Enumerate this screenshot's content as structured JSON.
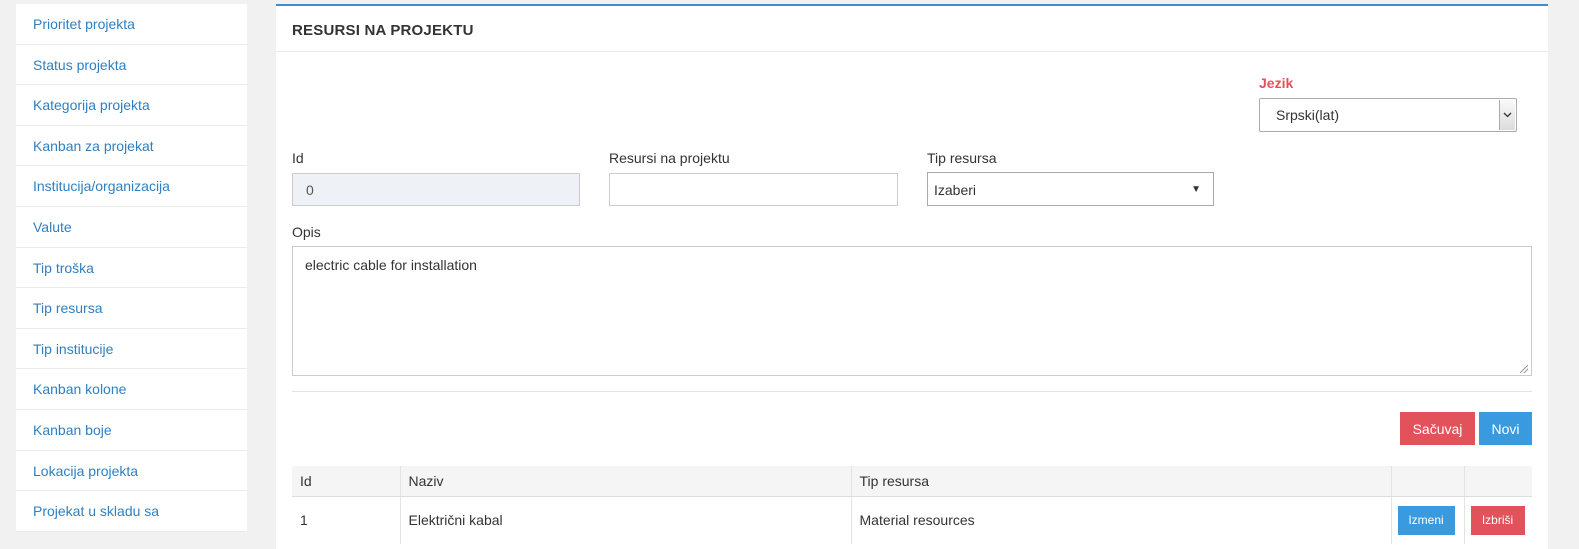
{
  "sidebar": {
    "items": [
      {
        "label": "Prioritet projekta"
      },
      {
        "label": "Status projekta"
      },
      {
        "label": "Kategorija projekta"
      },
      {
        "label": "Kanban za projekat"
      },
      {
        "label": "Institucija/organizacija"
      },
      {
        "label": "Valute"
      },
      {
        "label": "Tip troška"
      },
      {
        "label": "Tip resursa"
      },
      {
        "label": "Tip institucije"
      },
      {
        "label": "Kanban kolone"
      },
      {
        "label": "Kanban boje"
      },
      {
        "label": "Lokacija projekta"
      },
      {
        "label": "Projekat u skladu sa"
      }
    ]
  },
  "panel": {
    "title": "RESURSI NA PROJEKTU"
  },
  "language": {
    "label": "Jezik",
    "selected": "Srpski(lat)"
  },
  "form": {
    "id_label": "Id",
    "id_value": "0",
    "name_label": "Resursi na projektu",
    "name_value": "",
    "type_label": "Tip resursa",
    "type_selected": "Izaberi",
    "desc_label": "Opis",
    "desc_value": "electric cable for installation"
  },
  "actions": {
    "save_label": "Sačuvaj",
    "new_label": "Novi"
  },
  "table": {
    "headers": [
      "Id",
      "Naziv",
      "Tip resursa",
      "",
      ""
    ],
    "rows": [
      {
        "id": "1",
        "name": "Električni kabal",
        "type": "Material resources",
        "edit_label": "Izmeni",
        "delete_label": "Izbriši"
      }
    ]
  },
  "colors": {
    "link": "#2f7fc1",
    "primary": "#3a9ae0",
    "danger": "#e2525a",
    "panel_border": "#3a8fd8"
  }
}
